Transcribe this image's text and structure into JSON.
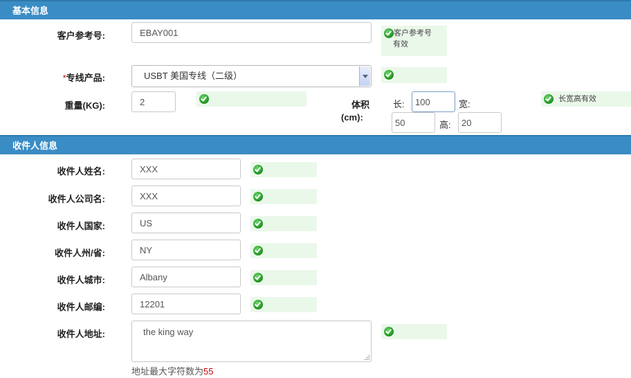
{
  "basic_section": {
    "title": "基本信息"
  },
  "ref": {
    "label": "客户参考号:",
    "value": "EBAY001",
    "valid_text_1": "客户参考号",
    "valid_text_2": "有效"
  },
  "product": {
    "required_mark": "*",
    "label": "专线产品:",
    "value": "USBT 美国专线（二级）"
  },
  "weight": {
    "label": "重量(KG):",
    "value": "2"
  },
  "volume": {
    "label_1": "体积",
    "label_2": "(cm):",
    "length_label": "长:",
    "length": "100",
    "width_label": "宽:",
    "width": "50",
    "height_label": "高:",
    "height": "20",
    "valid_text": "长宽高有效"
  },
  "recipient_section": {
    "title": "收件人信息"
  },
  "recipient": {
    "name": {
      "label": "收件人姓名:",
      "value": "XXX"
    },
    "company": {
      "label": "收件人公司名:",
      "value": "XXX"
    },
    "country": {
      "label": "收件人国家:",
      "value": "US"
    },
    "state": {
      "label": "收件人州/省:",
      "value": "NY"
    },
    "city": {
      "label": "收件人城市:",
      "value": "Albany"
    },
    "zip": {
      "label": "收件人邮编:",
      "value": "12201"
    },
    "address": {
      "label": "收件人地址:",
      "value": "the king way",
      "hint": "地址最大字符数为",
      "hint_max": "55"
    }
  },
  "colors": {
    "section_bar": "#3a8cc4",
    "valid_bg": "#eaf8ea",
    "ok_icon": "#1f8f1f",
    "required": "#cc0000"
  },
  "icons": {
    "valid": "check-circle-icon",
    "dropdown": "chevron-down-icon"
  }
}
